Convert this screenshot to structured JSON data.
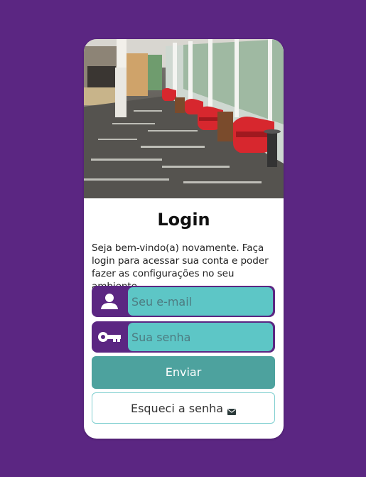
{
  "login": {
    "title": "Login",
    "description": "Seja bem-vindo(a) novamente. Faça login para acessar sua conta e poder fazer as configurações no seu ambiente.",
    "email": {
      "placeholder": "Seu e-mail",
      "icon": "user-icon",
      "value": ""
    },
    "password": {
      "placeholder": "Sua senha",
      "icon": "key-icon",
      "value": ""
    },
    "submit_label": "Enviar",
    "forgot_label": "Esqueci a senha",
    "forgot_icon": "envelope-icon"
  },
  "colors": {
    "background": "#5b2682",
    "field_fill": "#5dc6c6",
    "button": "#4da29e",
    "card": "#ffffff"
  }
}
